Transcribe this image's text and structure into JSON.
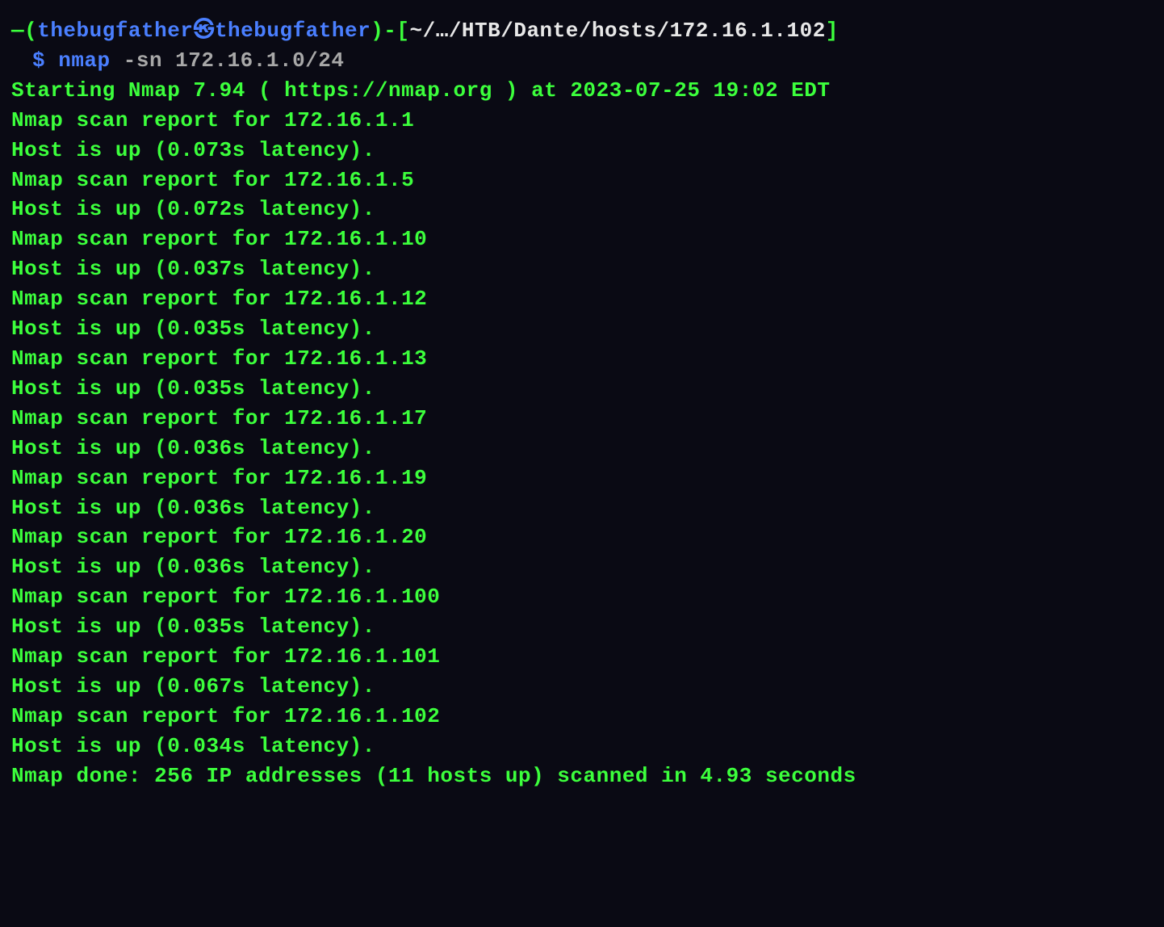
{
  "prompt": {
    "open_paren": "—(",
    "user_host": "thebugfather㉿thebugfather",
    "close_paren": ")",
    "dash": "-",
    "open_bracket": "[",
    "path": "~/…/HTB/Dante/hosts/172.16.1.102",
    "close_bracket": "]",
    "continuation": "└─",
    "symbol": "$",
    "command_name": "nmap",
    "command_args": " -sn 172.16.1.0/24"
  },
  "output": {
    "lines": [
      "Starting Nmap 7.94 ( https://nmap.org ) at 2023-07-25 19:02 EDT",
      "Nmap scan report for 172.16.1.1",
      "Host is up (0.073s latency).",
      "Nmap scan report for 172.16.1.5",
      "Host is up (0.072s latency).",
      "Nmap scan report for 172.16.1.10",
      "Host is up (0.037s latency).",
      "Nmap scan report for 172.16.1.12",
      "Host is up (0.035s latency).",
      "Nmap scan report for 172.16.1.13",
      "Host is up (0.035s latency).",
      "Nmap scan report for 172.16.1.17",
      "Host is up (0.036s latency).",
      "Nmap scan report for 172.16.1.19",
      "Host is up (0.036s latency).",
      "Nmap scan report for 172.16.1.20",
      "Host is up (0.036s latency).",
      "Nmap scan report for 172.16.1.100",
      "Host is up (0.035s latency).",
      "Nmap scan report for 172.16.1.101",
      "Host is up (0.067s latency).",
      "Nmap scan report for 172.16.1.102",
      "Host is up (0.034s latency).",
      "Nmap done: 256 IP addresses (11 hosts up) scanned in 4.93 seconds"
    ]
  }
}
